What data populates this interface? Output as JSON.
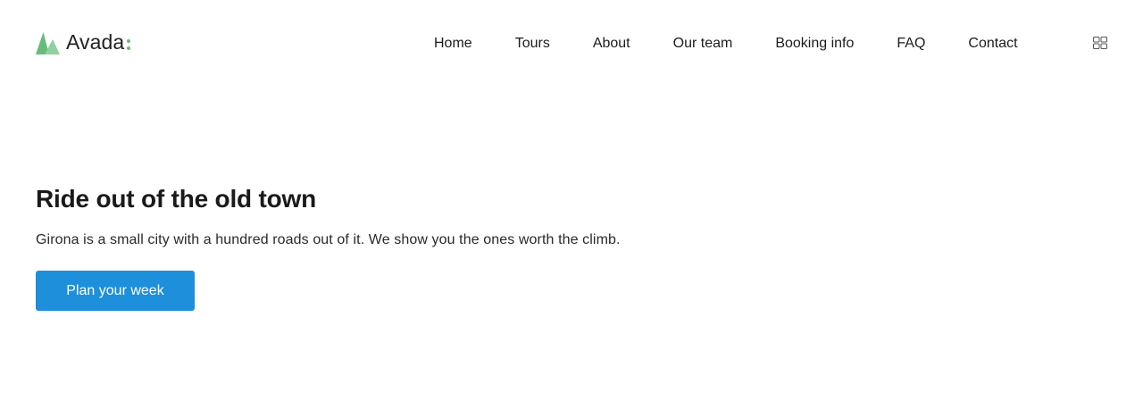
{
  "brand": {
    "name": "Avada",
    "logo_icon": "mountain-peaks-icon",
    "accent_color": "#65bc7b"
  },
  "nav": {
    "items": [
      {
        "label": "Home"
      },
      {
        "label": "Tours"
      },
      {
        "label": "About"
      },
      {
        "label": "Our team"
      },
      {
        "label": "Booking info"
      },
      {
        "label": "FAQ"
      },
      {
        "label": "Contact"
      }
    ],
    "menu_icon": "grid-menu-icon"
  },
  "hero": {
    "title": "Ride out of the old town",
    "subtitle": "Girona is a small city with a hundred roads out of it. We show you the ones worth the climb.",
    "cta_label": "Plan your week",
    "cta_color": "#1d8fdb"
  }
}
